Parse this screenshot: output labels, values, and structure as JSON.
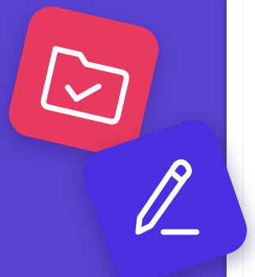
{
  "colors": {
    "background": "#5a41cf",
    "side_card": "#ffffff",
    "folder_tile": "#e8395f",
    "pencil_tile": "#4a2ee0",
    "icon_stroke": "#ffffff"
  },
  "tiles": [
    {
      "icon": "folder-check-icon",
      "color_key": "folder_tile"
    },
    {
      "icon": "pencil-icon",
      "color_key": "pencil_tile"
    }
  ]
}
